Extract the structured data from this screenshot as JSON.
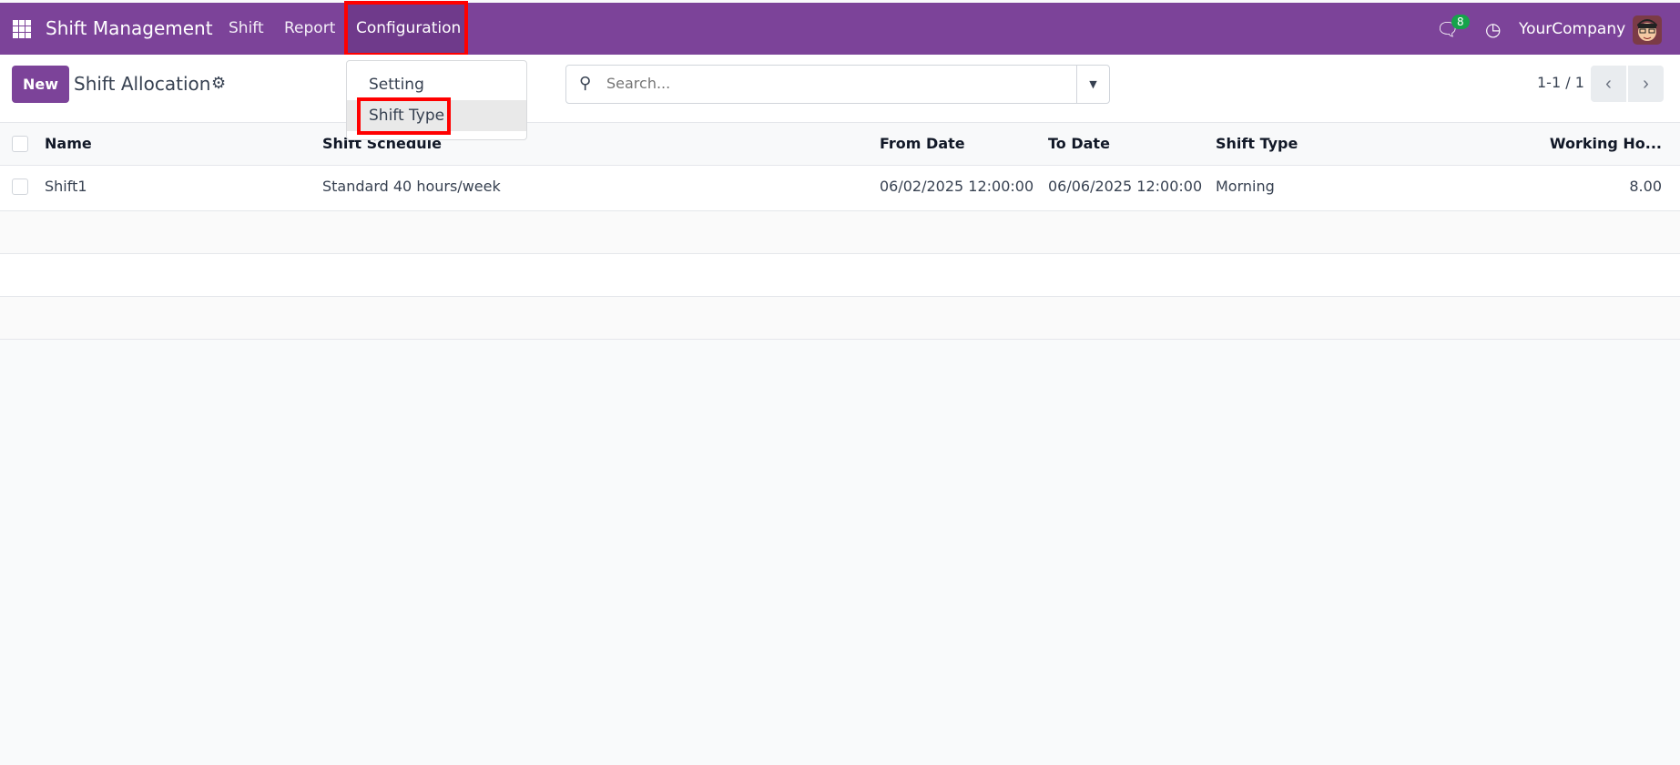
{
  "navbar": {
    "app_title": "Shift Management",
    "menus": [
      "Shift",
      "Report",
      "Configuration"
    ],
    "chat_count": "8",
    "company": "YourCompany",
    "accent": "#7c4399"
  },
  "control": {
    "new_label": "New",
    "page_title": "Shift Allocation",
    "search_placeholder": "Search...",
    "pager": "1-1 / 1"
  },
  "dropdown": {
    "items": [
      "Setting",
      "Shift Type"
    ]
  },
  "table": {
    "headers": [
      "Name",
      "Shift Schedule",
      "From Date",
      "To Date",
      "Shift Type",
      "Working Ho..."
    ],
    "rows": [
      [
        "Shift1",
        "Standard 40 hours/week",
        "06/02/2025 12:00:00",
        "06/06/2025 12:00:00",
        "Morning",
        "8.00"
      ]
    ]
  }
}
